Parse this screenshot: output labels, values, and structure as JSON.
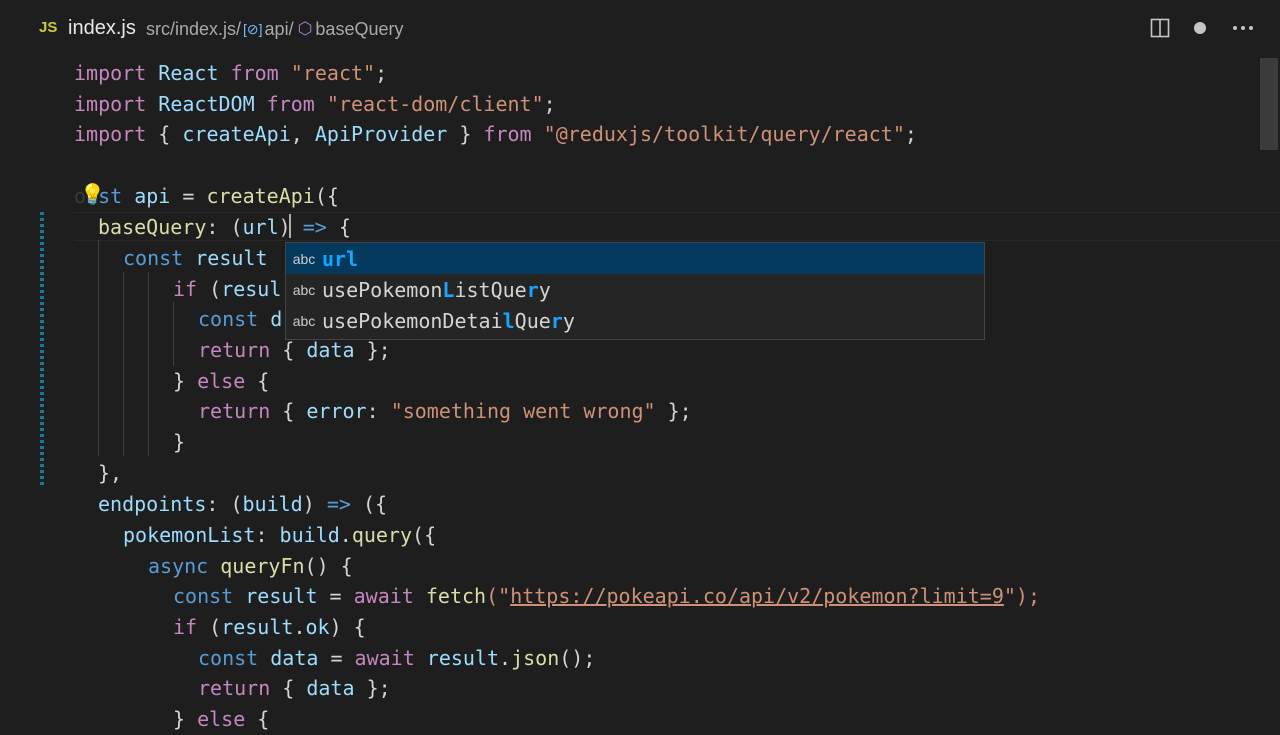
{
  "tab": {
    "lang_badge": "JS",
    "filename": "index.js"
  },
  "breadcrumb": {
    "path": "src/index.js/",
    "seg1": "api/",
    "seg2": "baseQuery"
  },
  "actions": {
    "split_icon": "split-editor-icon",
    "dirty_icon": "unsaved-dot-icon",
    "more_icon": "more-actions-icon"
  },
  "code": {
    "l1": [
      "import",
      "React",
      "from",
      "\"react\"",
      ";"
    ],
    "l2": [
      "import",
      "ReactDOM",
      "from",
      "\"react-dom/client\"",
      ";"
    ],
    "l3": [
      "import",
      "{ ",
      "createApi",
      ", ",
      "ApiProvider",
      " } ",
      "from",
      "\"@reduxjs/toolkit/query/react\"",
      ";"
    ],
    "l5": [
      "o",
      "nst ",
      "api",
      " = ",
      "createApi",
      "({"
    ],
    "l6": [
      "baseQuery",
      ": (",
      "url",
      ") ",
      "=>",
      " {"
    ],
    "l7": [
      "const ",
      "result"
    ],
    "l8": [
      "if",
      " (",
      "resul"
    ],
    "l9": [
      "const ",
      "d"
    ],
    "l10": [
      "return",
      " { ",
      "data",
      " };"
    ],
    "l11": [
      "} ",
      "else",
      " {"
    ],
    "l12": [
      "return",
      " { ",
      "error",
      ": ",
      "\"something went wrong\"",
      " };"
    ],
    "l13": [
      "}"
    ],
    "l14": [
      "},"
    ],
    "l15": [
      "endpoints",
      ": (",
      "build",
      ") ",
      "=>",
      " ({"
    ],
    "l16": [
      "pokemonList",
      ": ",
      "build",
      ".",
      "query",
      "({"
    ],
    "l17": [
      "async ",
      "queryFn",
      "() {"
    ],
    "l18": [
      "const ",
      "result",
      " = ",
      "await ",
      "fetch",
      "(\"",
      "https://pokeapi.co/api/v2/pokemon?limit=9",
      "\");"
    ],
    "l19": [
      "if",
      " (",
      "result",
      ".",
      "ok",
      ") {"
    ],
    "l20": [
      "const ",
      "data",
      " = ",
      "await ",
      "result",
      ".",
      "json",
      "();"
    ],
    "l21": [
      "return",
      " { ",
      "data",
      " };"
    ],
    "l22": [
      "} ",
      "else",
      " {"
    ]
  },
  "suggest": {
    "icon_label": "abc",
    "items": [
      {
        "pre": "",
        "hl": "url",
        "post": ""
      },
      {
        "p1": "u",
        "p2": "sePokemon",
        "p3": "L",
        "p4": "istQue",
        "p5": "r",
        "p6": "y"
      },
      {
        "p1": "u",
        "p2": "sePokemonDetai",
        "p3": "l",
        "p4": "Que",
        "p5": "r",
        "p6": "y"
      }
    ]
  }
}
